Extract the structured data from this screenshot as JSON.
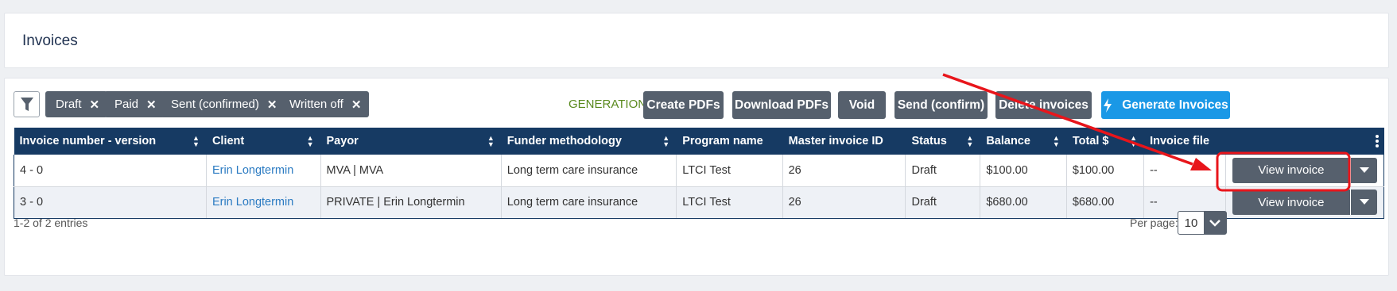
{
  "page": {
    "title": "Invoices"
  },
  "filters": {
    "chips": [
      {
        "label": "Draft"
      },
      {
        "label": "Paid"
      },
      {
        "label": "Sent (confirmed)"
      },
      {
        "label": "Written off"
      }
    ]
  },
  "toolbar": {
    "status": "GENERATION FINISHED",
    "create_pdfs": "Create PDFs",
    "download_pdfs": "Download PDFs",
    "void": "Void",
    "send_confirm": "Send (confirm)",
    "delete_invoices": "Delete invoices",
    "generate_invoices": "Generate Invoices"
  },
  "table": {
    "headers": [
      "Invoice number - version",
      "Client",
      "Payor",
      "Funder methodology",
      "Program name",
      "Master invoice ID",
      "Status",
      "Balance",
      "Total $",
      "Invoice file",
      ""
    ],
    "rows": [
      {
        "invoice": "4 - 0",
        "client": "Erin Longtermin",
        "payor": "MVA | MVA",
        "funder": "Long term care insurance",
        "program": "LTCI Test",
        "master_id": "26",
        "status": "Draft",
        "balance": "$100.00",
        "total": "$100.00",
        "file": "--",
        "action": "View invoice"
      },
      {
        "invoice": "3 - 0",
        "client": "Erin Longtermin",
        "payor": "PRIVATE | Erin Longtermin",
        "funder": "Long term care insurance",
        "program": "LTCI Test",
        "master_id": "26",
        "status": "Draft",
        "balance": "$680.00",
        "total": "$680.00",
        "file": "--",
        "action": "View invoice"
      }
    ]
  },
  "footer": {
    "entries": "1-2 of 2 entries",
    "per_page_label": "Per page:",
    "per_page_value": "10"
  },
  "colors": {
    "header_bg": "#163a63",
    "button_gray": "#56606d",
    "primary_blue": "#1a98e6",
    "status_green": "#5a8a1e",
    "annotation_red": "#e8151b"
  },
  "icons": [
    "filter-icon",
    "close-icon",
    "lightning-icon",
    "sort-icon",
    "kebab-menu-icon",
    "chevron-down-icon"
  ]
}
